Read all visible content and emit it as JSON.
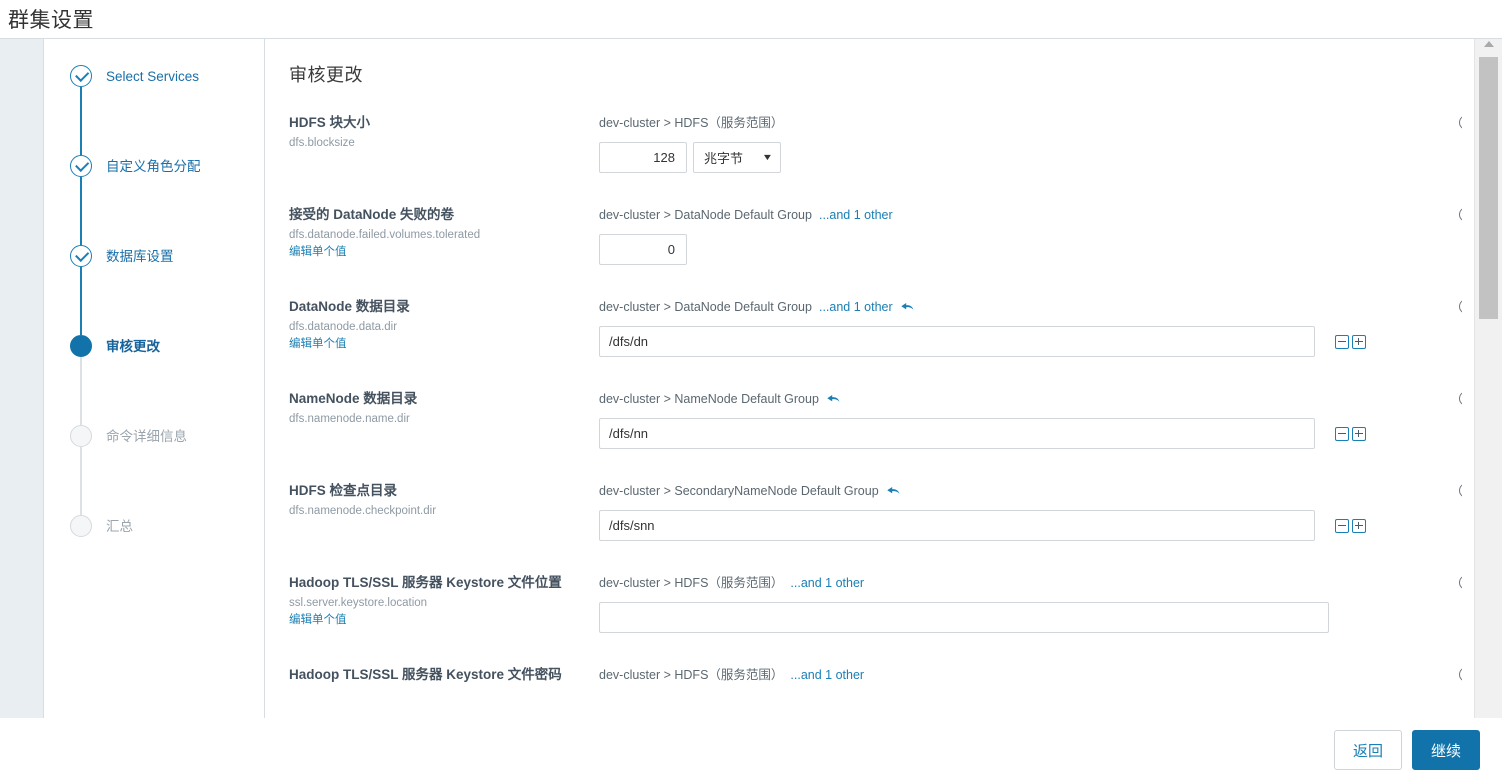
{
  "header": {
    "title": "群集设置"
  },
  "sidebar": {
    "steps": [
      {
        "label": "Select Services",
        "state": "done"
      },
      {
        "label": "自定义角色分配",
        "state": "done"
      },
      {
        "label": "数据库设置",
        "state": "done"
      },
      {
        "label": "审核更改",
        "state": "current"
      },
      {
        "label": "命令详细信息",
        "state": "todo"
      },
      {
        "label": "汇总",
        "state": "todo"
      }
    ]
  },
  "main": {
    "title": "审核更改",
    "edit_single_value_label": "编辑单个值",
    "help_glyph": "?",
    "rows": [
      {
        "name": "HDFS 块大小",
        "property": "dfs.blocksize",
        "edit_link": "",
        "scope": "dev-cluster > HDFS（服务范围）",
        "more": "",
        "undo": false,
        "field_type": "number_unit",
        "value": "128",
        "unit": "兆字节"
      },
      {
        "name": "接受的 DataNode 失败的卷",
        "property": "dfs.datanode.failed.volumes.tolerated",
        "edit_link": "编辑单个值",
        "scope": "dev-cluster > DataNode Default Group",
        "more": "...and 1 other",
        "undo": false,
        "field_type": "number",
        "value": "0",
        "unit": ""
      },
      {
        "name": "DataNode 数据目录",
        "property": "dfs.datanode.data.dir",
        "edit_link": "编辑单个值",
        "scope": "dev-cluster > DataNode Default Group",
        "more": "...and 1 other",
        "undo": true,
        "field_type": "path",
        "value": "/dfs/dn",
        "unit": ""
      },
      {
        "name": "NameNode 数据目录",
        "property": "dfs.namenode.name.dir",
        "edit_link": "",
        "scope": "dev-cluster > NameNode Default Group",
        "more": "",
        "undo": true,
        "field_type": "path",
        "value": "/dfs/nn",
        "unit": ""
      },
      {
        "name": "HDFS 检查点目录",
        "property": "dfs.namenode.checkpoint.dir",
        "edit_link": "",
        "scope": "dev-cluster > SecondaryNameNode Default Group",
        "more": "",
        "undo": true,
        "field_type": "path",
        "value": "/dfs/snn",
        "unit": ""
      },
      {
        "name": "Hadoop TLS/SSL 服务器 Keystore 文件位置",
        "property": "ssl.server.keystore.location",
        "edit_link": "编辑单个值",
        "scope": "dev-cluster > HDFS（服务范围）",
        "more": "...and 1 other",
        "undo": false,
        "field_type": "text",
        "value": "",
        "unit": ""
      },
      {
        "name": "Hadoop TLS/SSL 服务器 Keystore 文件密码",
        "property": "",
        "edit_link": "",
        "scope": "dev-cluster > HDFS（服务范围）",
        "more": "...and 1 other",
        "undo": false,
        "field_type": "none",
        "value": "",
        "unit": ""
      }
    ]
  },
  "footer": {
    "back_label": "返回",
    "continue_label": "继续"
  },
  "colors": {
    "accent": "#1273ab",
    "link": "#1a7fb5",
    "label": "#44515e",
    "muted": "#8e9aa4"
  }
}
